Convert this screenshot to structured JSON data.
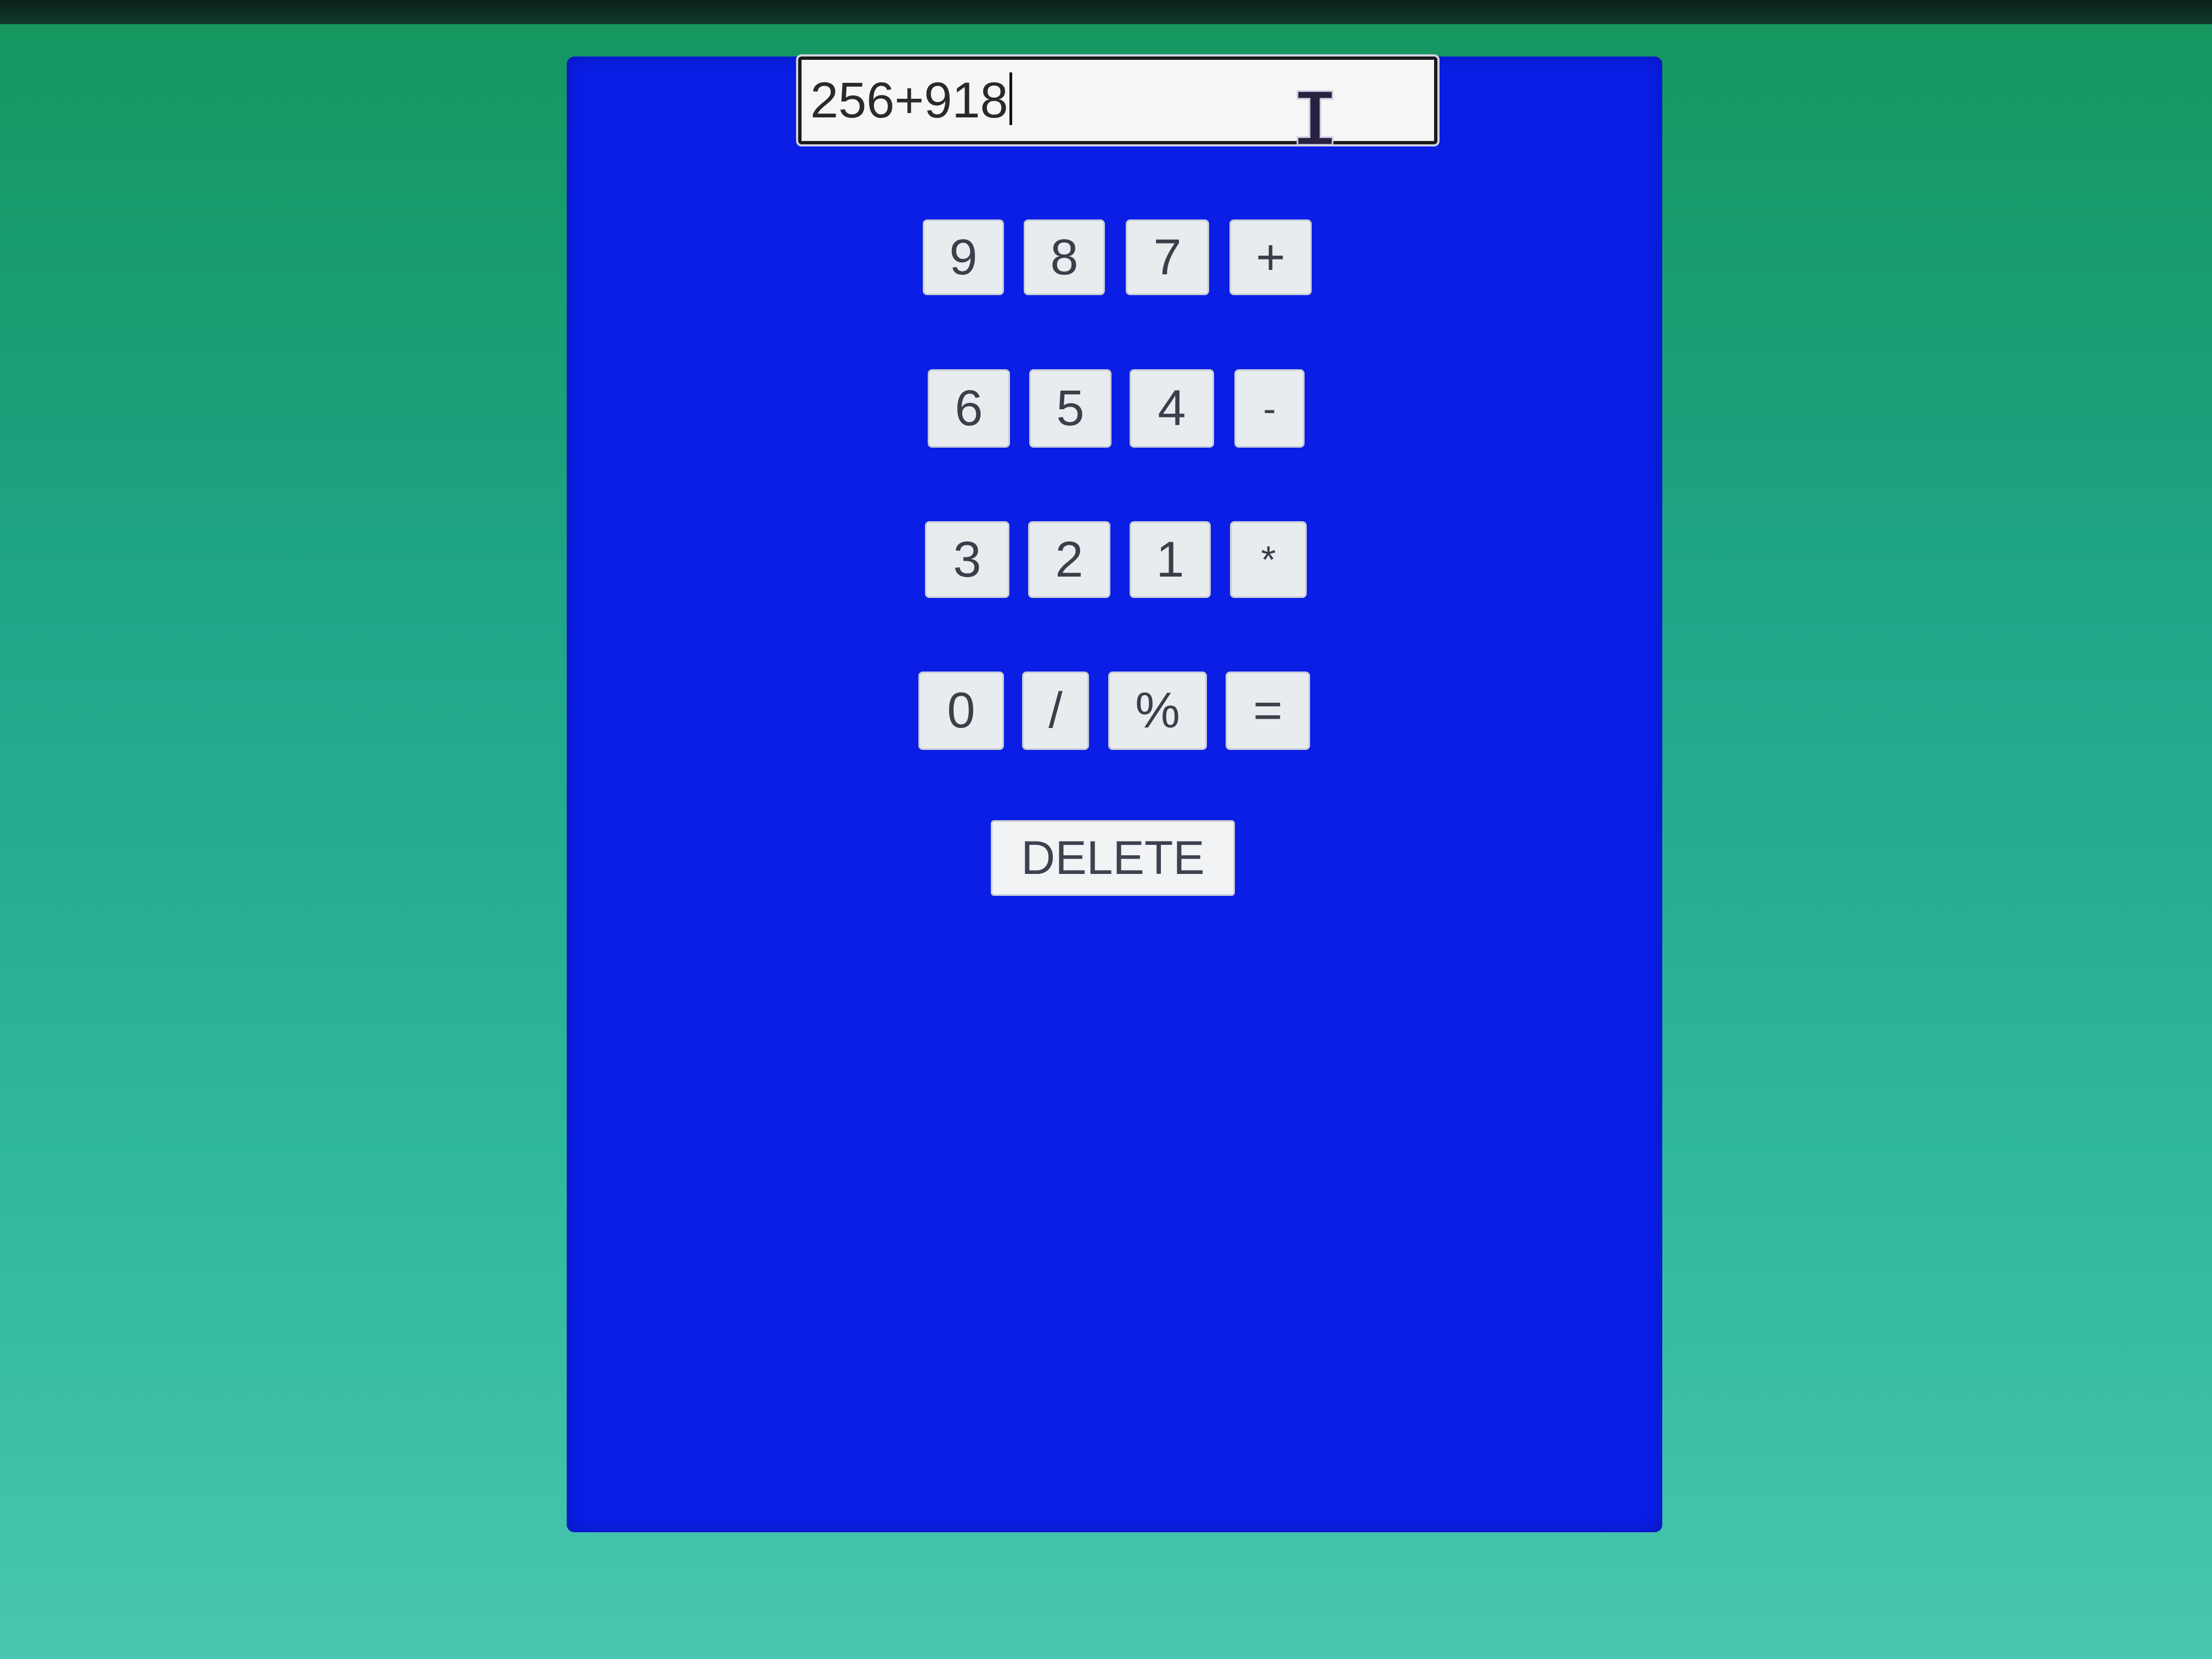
{
  "calculator": {
    "display_value": "256+918",
    "keys": {
      "row1": [
        "9",
        "8",
        "7",
        "+"
      ],
      "row2": [
        "6",
        "5",
        "4",
        "-"
      ],
      "row3": [
        "3",
        "2",
        "1",
        "*"
      ],
      "row4": [
        "0",
        "/",
        "%",
        "="
      ]
    },
    "delete_label": "DELETE"
  },
  "colors": {
    "background": "#1fa486",
    "panel": "#0a1ee6",
    "key_face": "#e9ecef",
    "key_text": "#3a3f4a"
  },
  "cursor": {
    "icon": "text-cursor-ibeam-icon"
  }
}
